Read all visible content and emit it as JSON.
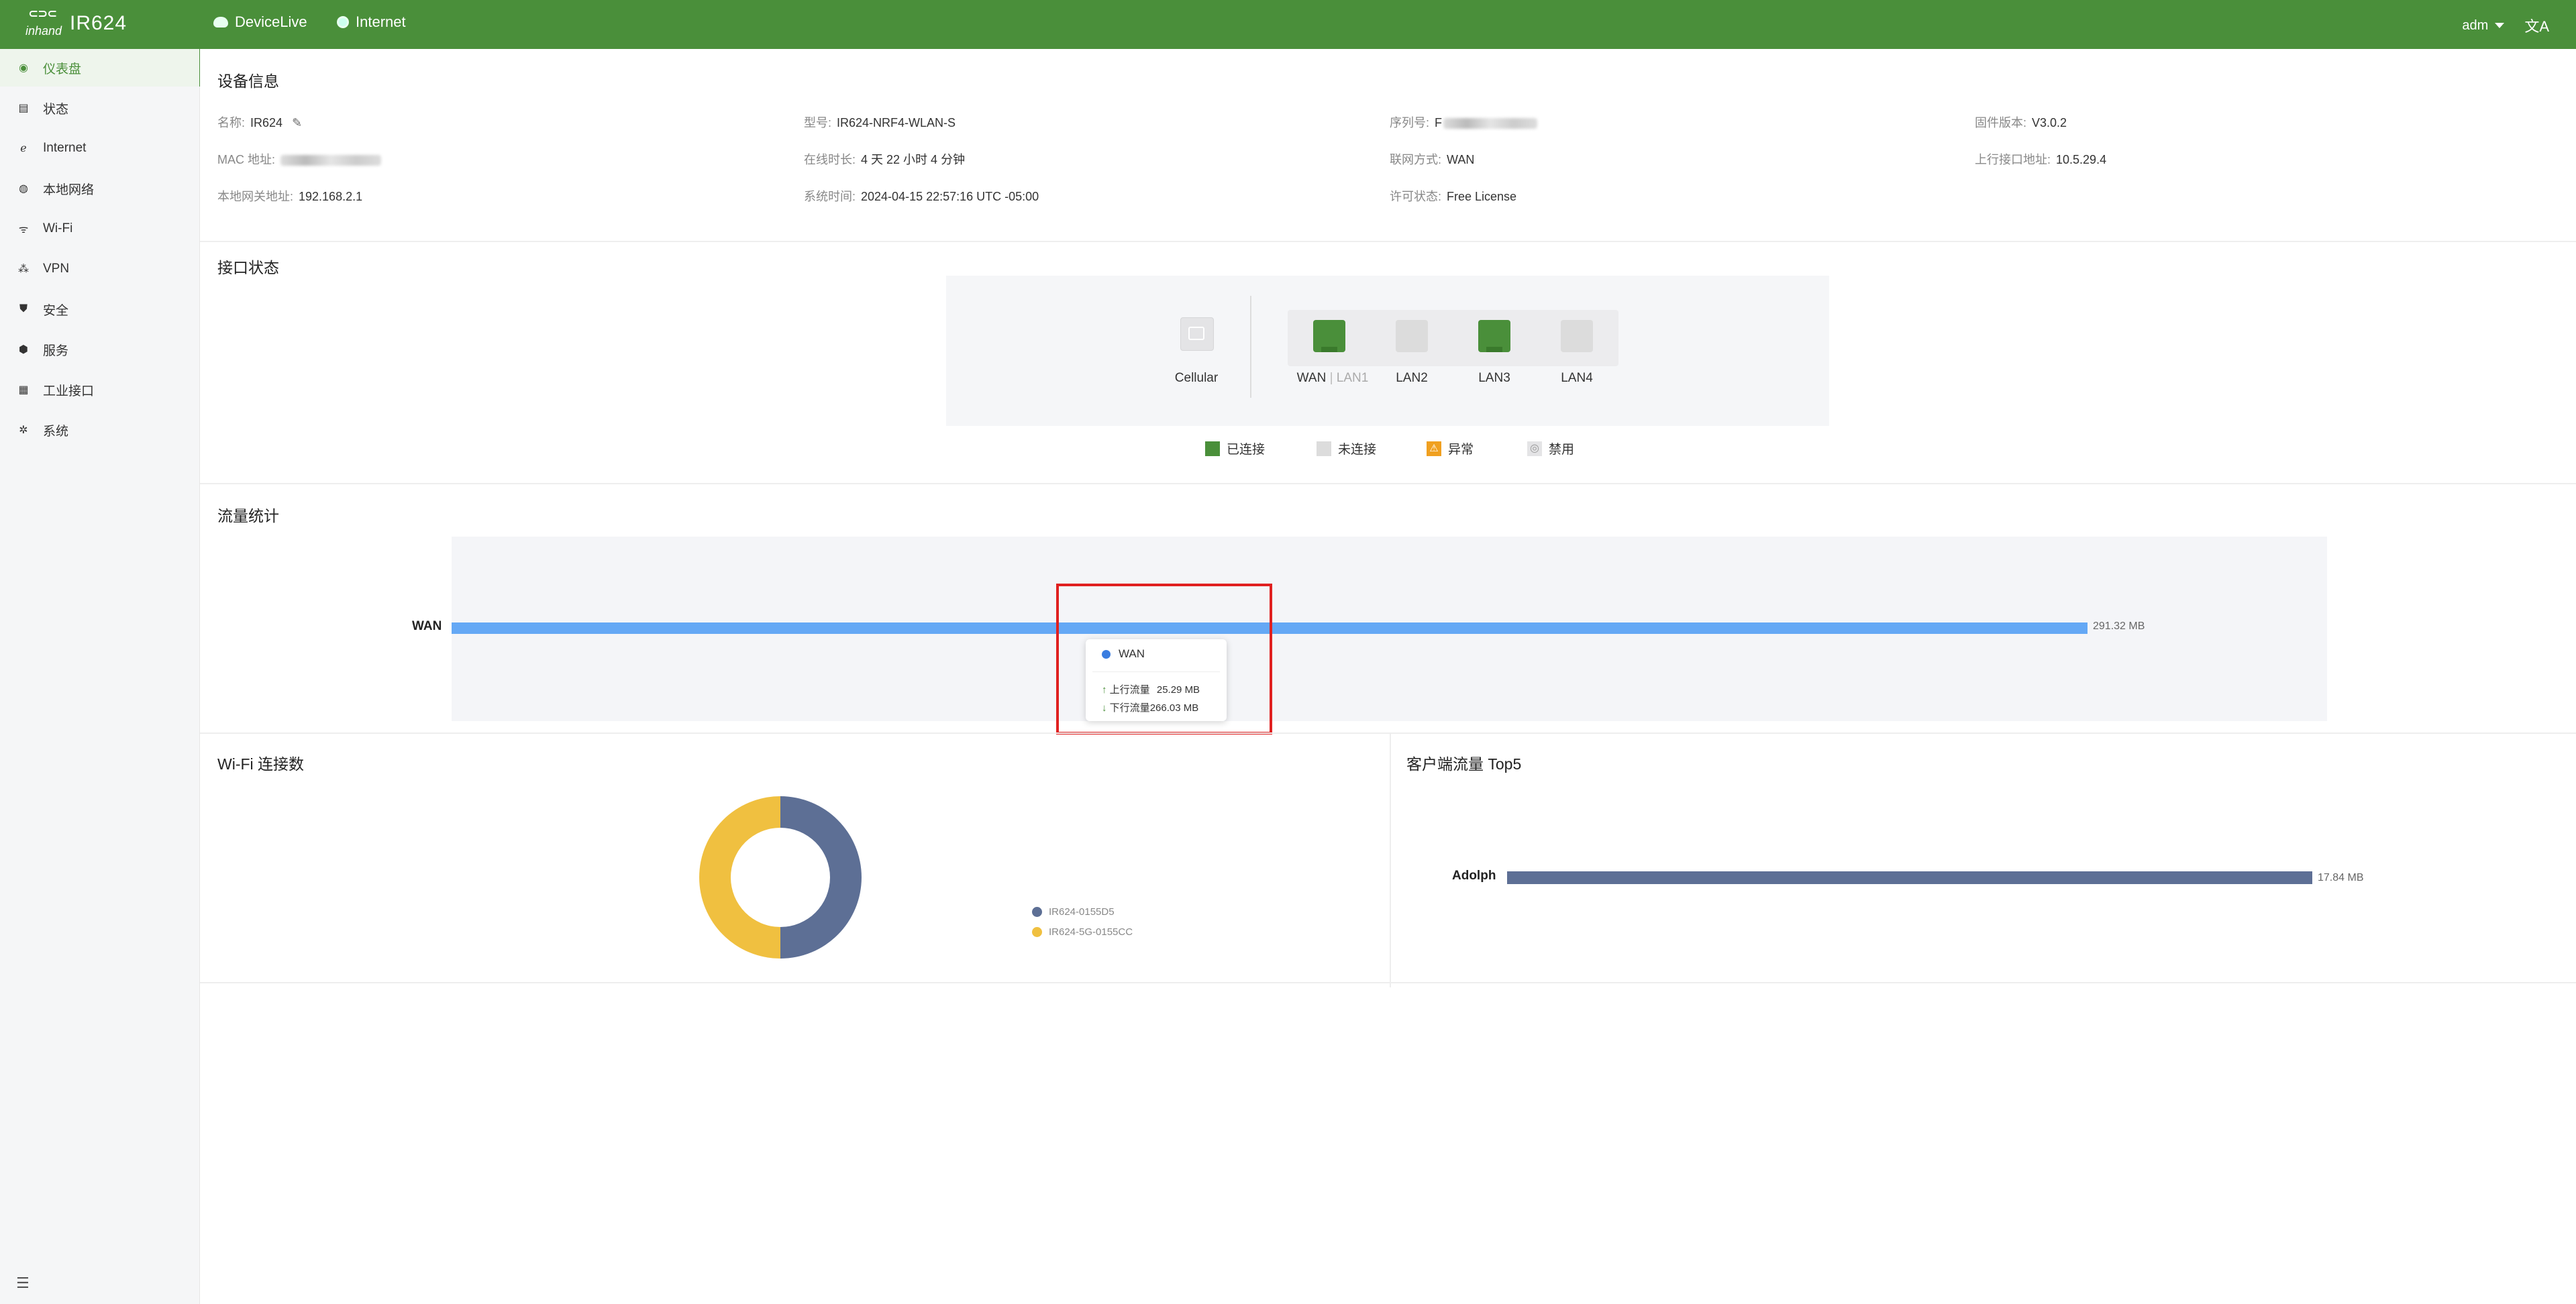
{
  "header": {
    "brand_logo_line1": "⊂⊃⊂",
    "brand_logo_line2": "inhand",
    "brand_name": "IR624",
    "device_live": "DeviceLive",
    "internet": "Internet",
    "user": "adm",
    "lang_icon": "文A"
  },
  "sidebar": {
    "items": [
      {
        "label": "仪表盘",
        "icon": "dashboard-icon",
        "glyph": "◉"
      },
      {
        "label": "状态",
        "icon": "status-icon",
        "glyph": "▤"
      },
      {
        "label": "Internet",
        "icon": "internet-icon",
        "glyph": "ℯ"
      },
      {
        "label": "本地网络",
        "icon": "local-network-icon",
        "glyph": "◍"
      },
      {
        "label": "Wi-Fi",
        "icon": "wifi-icon",
        "glyph": "ᯤ"
      },
      {
        "label": "VPN",
        "icon": "vpn-icon",
        "glyph": "⁂"
      },
      {
        "label": "安全",
        "icon": "security-icon",
        "glyph": "⛊"
      },
      {
        "label": "服务",
        "icon": "service-icon",
        "glyph": "⬢"
      },
      {
        "label": "工业接口",
        "icon": "industrial-port-icon",
        "glyph": "▦"
      },
      {
        "label": "系统",
        "icon": "system-icon",
        "glyph": "✲"
      }
    ],
    "collapse_glyph": "☰"
  },
  "device_info": {
    "title": "设备信息",
    "name_label": "名称:",
    "name_value": "IR624",
    "model_label": "型号:",
    "model_value": "IR624-NRF4-WLAN-S",
    "serial_label": "序列号:",
    "serial_value": "F",
    "firmware_label": "固件版本:",
    "firmware_value": "V3.0.2",
    "mac_label": "MAC 地址:",
    "mac_value": "",
    "uptime_label": "在线时长:",
    "uptime_value": "4 天 22 小时 4 分钟",
    "network_mode_label": "联网方式:",
    "network_mode_value": "WAN",
    "uplink_ip_label": "上行接口地址:",
    "uplink_ip_value": "10.5.29.4",
    "gateway_label": "本地网关地址:",
    "gateway_value": "192.168.2.1",
    "system_time_label": "系统时间:",
    "system_time_value": "2024-04-15 22:57:16 UTC -05:00",
    "license_label": "许可状态:",
    "license_value": "Free License"
  },
  "interface_status": {
    "title": "接口状态",
    "cellular": "Cellular",
    "wan": "WAN",
    "wan_sep": " | ",
    "wan_alt": "LAN1",
    "lan2": "LAN2",
    "lan3": "LAN3",
    "lan4": "LAN4",
    "legend": {
      "connected": "已连接",
      "disconnected": "未连接",
      "abnormal": "异常",
      "disabled": "禁用",
      "abnormal_glyph": "⚠",
      "disabled_glyph": "◎"
    },
    "colors": {
      "connected": "#4a8f3a",
      "disconnected": "#dcdcdc",
      "abnormal": "#f0a020"
    }
  },
  "traffic": {
    "title": "流量统计",
    "tooltip": {
      "series": "WAN",
      "up_arrow": "↑",
      "up_label": "上行流量",
      "up_value": "25.29 MB",
      "down_arrow": "↓",
      "down_label": "下行流量",
      "down_value": "266.03 MB"
    }
  },
  "wifi": {
    "title": "Wi-Fi 连接数",
    "legend": [
      "IR624-0155D5",
      "IR624-5G-0155CC"
    ]
  },
  "clients": {
    "title": "客户端流量 Top5"
  },
  "chart_data": [
    {
      "type": "bar",
      "orientation": "horizontal",
      "categories": [
        "WAN"
      ],
      "values": [
        291.32
      ],
      "value_labels": [
        "291.32 MB"
      ],
      "max": 291.32
    },
    {
      "type": "pie",
      "donut": true,
      "categories": [
        "IR624-0155D5",
        "IR624-5G-0155CC"
      ],
      "values": [
        1,
        1
      ],
      "colors": [
        "#5d6f95",
        "#f0c040"
      ]
    },
    {
      "type": "bar",
      "orientation": "horizontal",
      "categories": [
        "Adolph"
      ],
      "values": [
        17.84
      ],
      "value_labels": [
        "17.84 MB"
      ],
      "max": 17.84
    }
  ]
}
